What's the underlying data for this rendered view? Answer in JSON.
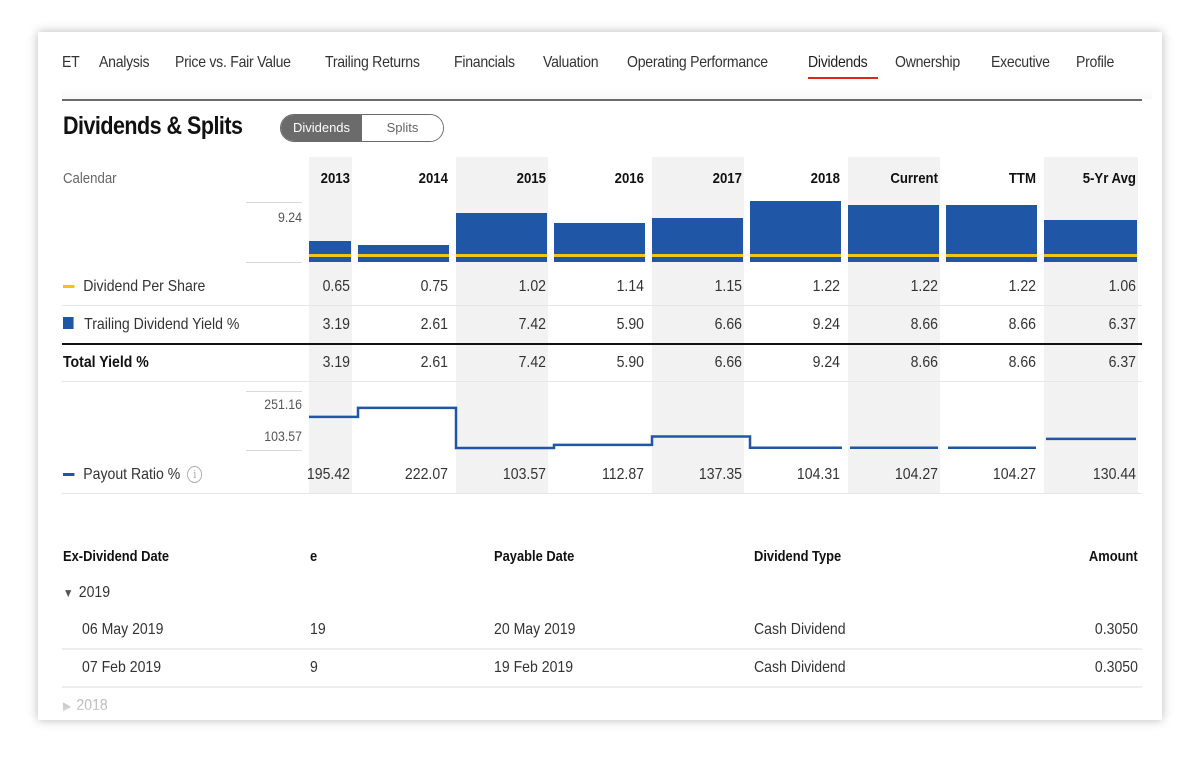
{
  "nav": {
    "items": [
      {
        "label": "ET"
      },
      {
        "label": "Analysis"
      },
      {
        "label": "Price vs. Fair Value"
      },
      {
        "label": "Trailing Returns"
      },
      {
        "label": "Financials"
      },
      {
        "label": "Valuation"
      },
      {
        "label": "Operating Performance"
      },
      {
        "label": "Dividends",
        "active": true
      },
      {
        "label": "Ownership"
      },
      {
        "label": "Executive"
      },
      {
        "label": "Profile"
      }
    ],
    "active_color": "#e0261c"
  },
  "section": {
    "title": "Dividends & Splits",
    "toggle": {
      "selected": "Dividends",
      "options": [
        "Dividends",
        "Splits"
      ]
    }
  },
  "summary": {
    "calendar_label": "Calendar",
    "columns": [
      "2013",
      "2014",
      "2015",
      "2016",
      "2017",
      "2018",
      "Current",
      "TTM",
      "5-Yr Avg"
    ],
    "yield_axis_max": "9.24",
    "payout_axis_max": "251.16",
    "payout_axis_min": "103.57",
    "rows": {
      "dps": {
        "label": "Dividend Per Share",
        "values": [
          "0.65",
          "0.75",
          "1.02",
          "1.14",
          "1.15",
          "1.22",
          "1.22",
          "1.22",
          "1.06"
        ]
      },
      "yield": {
        "label": "Trailing Dividend Yield %",
        "values": [
          "3.19",
          "2.61",
          "7.42",
          "5.90",
          "6.66",
          "9.24",
          "8.66",
          "8.66",
          "6.37"
        ]
      },
      "total": {
        "label": "Total Yield %",
        "values": [
          "3.19",
          "2.61",
          "7.42",
          "5.90",
          "6.66",
          "9.24",
          "8.66",
          "8.66",
          "6.37"
        ]
      },
      "payout": {
        "label": "Payout Ratio %",
        "values": [
          "195.42",
          "222.07",
          "103.57",
          "112.87",
          "137.35",
          "104.31",
          "104.27",
          "104.27",
          "130.44"
        ]
      }
    },
    "colors": {
      "dps": "#f2c413",
      "yield": "#1f56a6",
      "payout": "#1f56a6"
    }
  },
  "chart_data": {
    "type": "bar",
    "categories": [
      "2013",
      "2014",
      "2015",
      "2016",
      "2017",
      "2018",
      "Current",
      "TTM",
      "5-Yr Avg"
    ],
    "series": [
      {
        "name": "Trailing Dividend Yield %",
        "type": "bar",
        "values": [
          3.19,
          2.61,
          7.42,
          5.9,
          6.66,
          9.24,
          8.66,
          8.66,
          6.37
        ]
      },
      {
        "name": "Dividend Per Share",
        "type": "line",
        "values": [
          0.65,
          0.75,
          1.02,
          1.14,
          1.15,
          1.22,
          1.22,
          1.22,
          1.06
        ]
      },
      {
        "name": "Payout Ratio %",
        "type": "step-line",
        "values": [
          195.42,
          222.07,
          103.57,
          112.87,
          137.35,
          104.31,
          104.27,
          104.27,
          130.44
        ]
      }
    ],
    "yield_axis": {
      "max": 9.24
    },
    "payout_axis": {
      "max": 251.16,
      "min": 103.57
    }
  },
  "history": {
    "headers": {
      "ex_date": "Ex-Dividend Date",
      "record_date_fragment": "e",
      "payable_date": "Payable Date",
      "type": "Dividend Type",
      "amount": "Amount"
    },
    "groups": [
      {
        "year": "2019",
        "expanded": true,
        "rows": [
          {
            "ex_date": "06 May 2019",
            "record_fragment": "19",
            "payable": "20 May 2019",
            "type": "Cash Dividend",
            "amount": "0.3050"
          },
          {
            "ex_date": "07 Feb 2019",
            "record_fragment": "9",
            "payable": "19 Feb 2019",
            "type": "Cash Dividend",
            "amount": "0.3050"
          }
        ]
      },
      {
        "year": "2018",
        "expanded": false
      }
    ]
  }
}
